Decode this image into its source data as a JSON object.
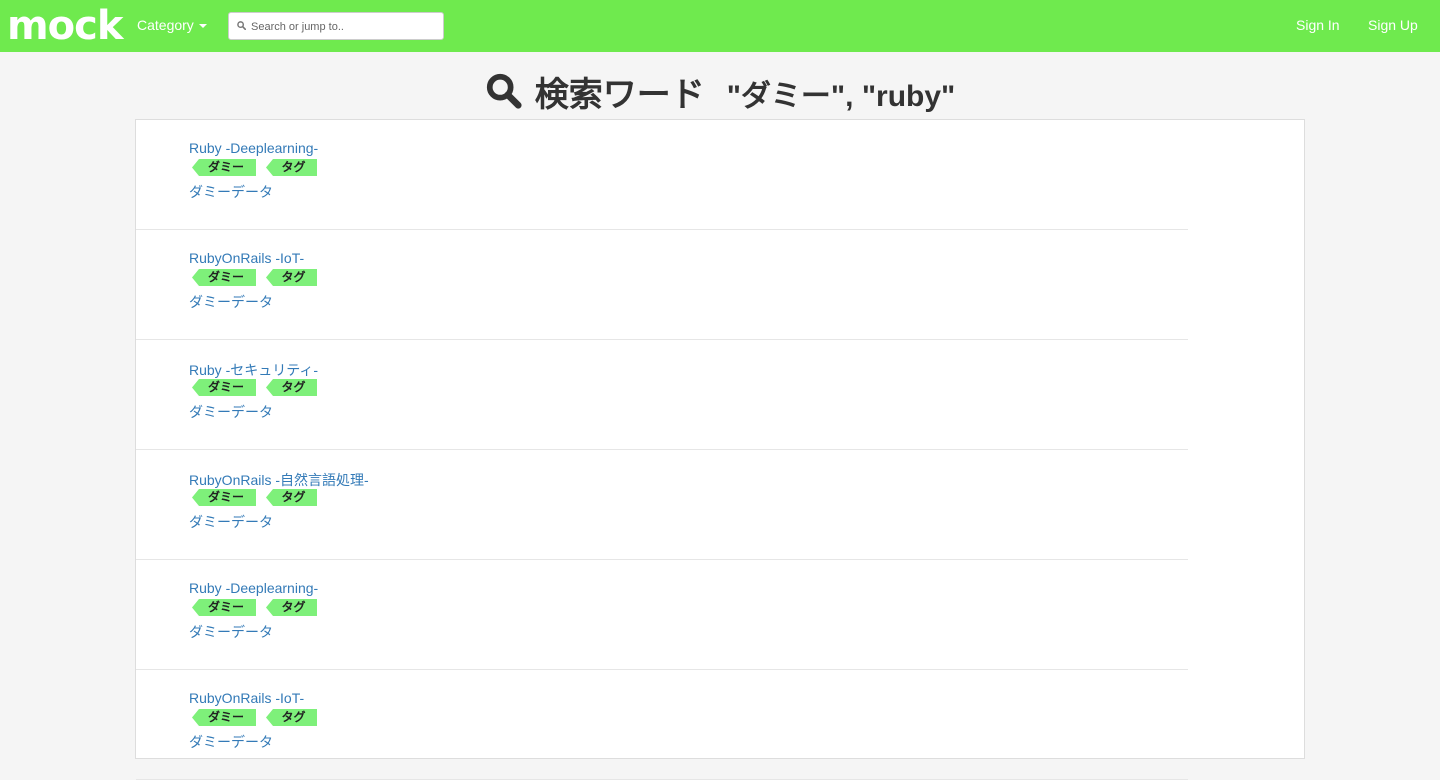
{
  "navbar": {
    "brand": "mock",
    "category_label": "Category",
    "search_placeholder": "Search or jump to..",
    "signin_label": "Sign In",
    "signup_label": "Sign Up",
    "bg_color": "#6fea4e"
  },
  "heading": {
    "title": "検索ワード",
    "query": "\"ダミー\", \"ruby\""
  },
  "results": [
    {
      "title": "Ruby -Deeplearning-",
      "tags": [
        "ダミー",
        "タグ"
      ],
      "desc": "ダミーデータ"
    },
    {
      "title": "RubyOnRails -IoT-",
      "tags": [
        "ダミー",
        "タグ"
      ],
      "desc": "ダミーデータ"
    },
    {
      "title": "Ruby -セキュリティ-",
      "tags": [
        "ダミー",
        "タグ"
      ],
      "desc": "ダミーデータ"
    },
    {
      "title": "RubyOnRails -自然言語処理-",
      "tags": [
        "ダミー",
        "タグ"
      ],
      "desc": "ダミーデータ"
    },
    {
      "title": "Ruby -Deeplearning-",
      "tags": [
        "ダミー",
        "タグ"
      ],
      "desc": "ダミーデータ"
    },
    {
      "title": "RubyOnRails -IoT-",
      "tags": [
        "ダミー",
        "タグ"
      ],
      "desc": "ダミーデータ"
    }
  ],
  "icons": {
    "search": "search-icon",
    "heading": "search-icon",
    "dropdown": "chevron-down-icon"
  },
  "colors": {
    "link": "#337ab7",
    "tag": "#7ef07a"
  }
}
